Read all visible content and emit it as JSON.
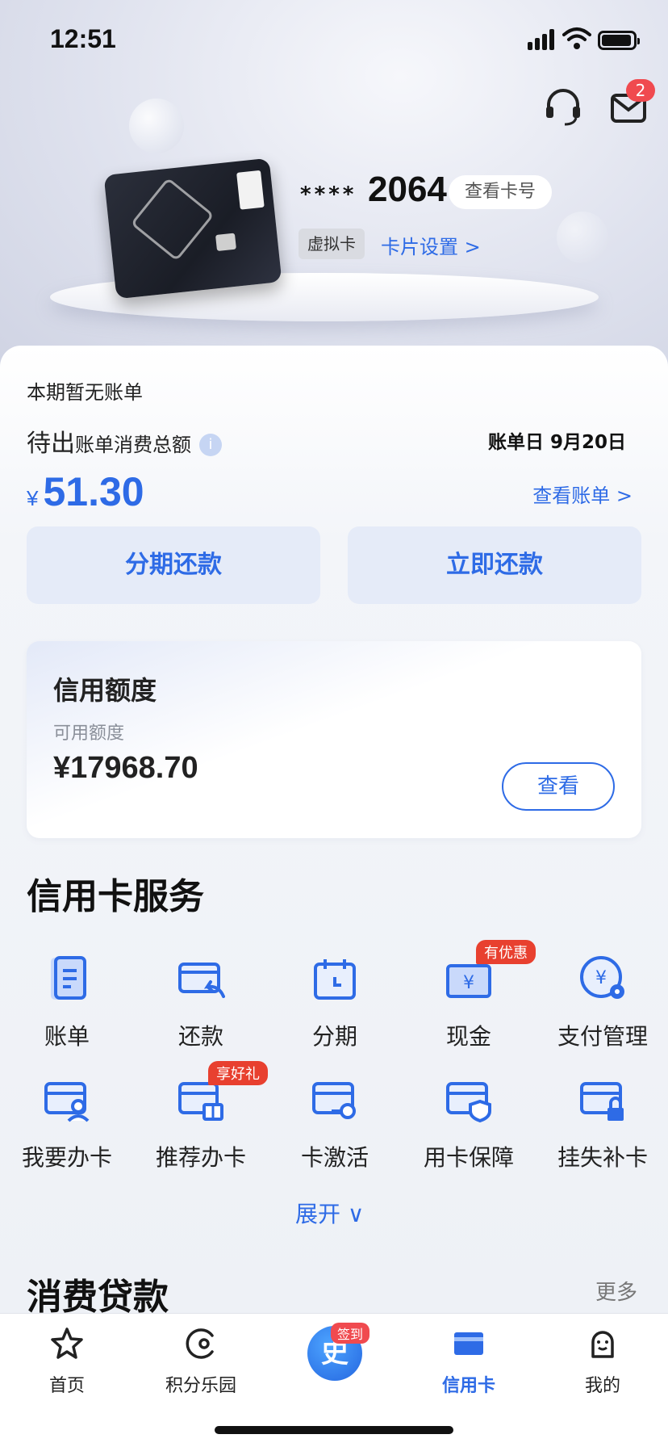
{
  "status_bar": {
    "time": "12:51"
  },
  "header": {
    "mail_badge": "2"
  },
  "card": {
    "masked": "****",
    "last4": "2064",
    "view_number_label": "查看卡号",
    "virtual_tag": "虚拟卡",
    "settings_label": "卡片设置 >"
  },
  "bill": {
    "no_bill": "本期暂无账单",
    "pending_prefix": "待出",
    "pending_suffix": "账单消费总额",
    "info_icon": "i",
    "bill_day": "账单日 9月20日",
    "currency": "¥",
    "amount": "51.30",
    "view_bill": "查看账单 >",
    "installment_repay": "分期还款",
    "repay_now": "立即还款"
  },
  "credit_limit": {
    "title": "信用额度",
    "sub": "可用额度",
    "value": "¥17968.70",
    "view": "查看"
  },
  "services": {
    "title": "信用卡服务",
    "items": [
      {
        "label": "账单",
        "icon": "bill-icon"
      },
      {
        "label": "还款",
        "icon": "repay-icon"
      },
      {
        "label": "分期",
        "icon": "calendar-icon"
      },
      {
        "label": "现金",
        "icon": "cash-icon",
        "promo": "有优惠"
      },
      {
        "label": "支付管理",
        "icon": "payment-settings-icon"
      },
      {
        "label": "我要办卡",
        "icon": "apply-card-icon"
      },
      {
        "label": "推荐办卡",
        "icon": "recommend-card-icon",
        "promo": "享好礼"
      },
      {
        "label": "卡激活",
        "icon": "activate-card-icon"
      },
      {
        "label": "用卡保障",
        "icon": "card-protection-icon"
      },
      {
        "label": "挂失补卡",
        "icon": "lost-card-icon"
      }
    ],
    "expand": "展开 ∨"
  },
  "loans": {
    "title": "消费贷款",
    "more": "更多"
  },
  "tabbar": {
    "tabs": [
      {
        "label": "首页",
        "icon": "star-icon"
      },
      {
        "label": "积分乐园",
        "icon": "points-icon"
      },
      {
        "label": "",
        "icon": "checkin-icon",
        "badge": "签到",
        "glyph": "史"
      },
      {
        "label": "信用卡",
        "icon": "credit-card-icon",
        "active": true
      },
      {
        "label": "我的",
        "icon": "profile-icon"
      }
    ]
  },
  "colors": {
    "accent": "#2e6be6",
    "promo": "#e8402f",
    "badge": "#f04a4f"
  }
}
